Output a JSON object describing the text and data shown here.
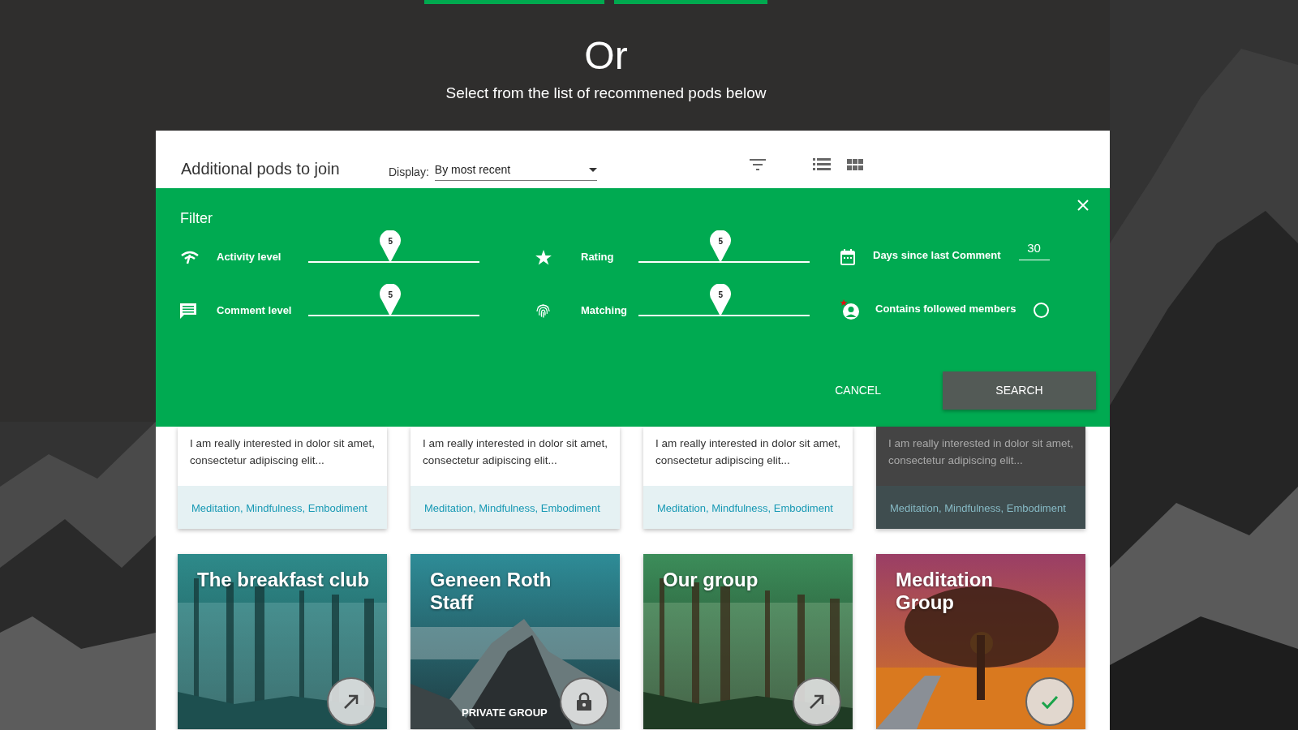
{
  "heading": "Or",
  "subheading": "Select from the list of recommened pods below",
  "panel": {
    "title": "Additional pods to join",
    "display": {
      "label": "Display:",
      "value": "By most recent"
    }
  },
  "filter": {
    "title": "Filter",
    "rows": [
      {
        "sliders": [
          {
            "label": "Activity level",
            "value": "5",
            "level": 0.48
          },
          {
            "label": "Rating",
            "value": "5",
            "level": 0.48
          }
        ],
        "option": {
          "kind": "number",
          "label": "Days since last Comment",
          "value": "30"
        }
      },
      {
        "sliders": [
          {
            "label": "Comment level",
            "value": "5",
            "level": 0.48
          },
          {
            "label": "Matching",
            "value": "5",
            "level": 0.48
          }
        ],
        "option": {
          "kind": "toggle",
          "label": "Contains followed members",
          "checked": false
        }
      }
    ],
    "cancel": "CANCEL",
    "search": "SEARCH"
  },
  "pods_top": [
    {
      "description": "I am really interested in dolor sit amet, consectetur adipiscing elit...",
      "tags": "Meditation, Mindfulness, Embodiment",
      "dimmed": false
    },
    {
      "description": "I am really interested in dolor sit amet, consectetur adipiscing elit...",
      "tags": "Meditation, Mindfulness, Embodiment",
      "dimmed": false
    },
    {
      "description": "I am really interested in dolor sit amet, consectetur adipiscing elit...",
      "tags": "Meditation, Mindfulness, Embodiment",
      "dimmed": false
    },
    {
      "description": "I am really interested in dolor sit amet, consectetur adipiscing elit...",
      "tags": "Meditation, Mindfulness, Embodiment",
      "dimmed": true
    }
  ],
  "pods_bottom": [
    {
      "title_lines": [
        "The breakfast club"
      ],
      "kind": "open"
    },
    {
      "title_lines": [
        "Geneen Roth",
        "Staff"
      ],
      "badge": "PRIVATE GROUP",
      "kind": "locked"
    },
    {
      "title_lines": [
        "Our group"
      ],
      "kind": "open"
    },
    {
      "title_lines": [
        "Meditation",
        "Group"
      ],
      "kind": "joined"
    }
  ]
}
